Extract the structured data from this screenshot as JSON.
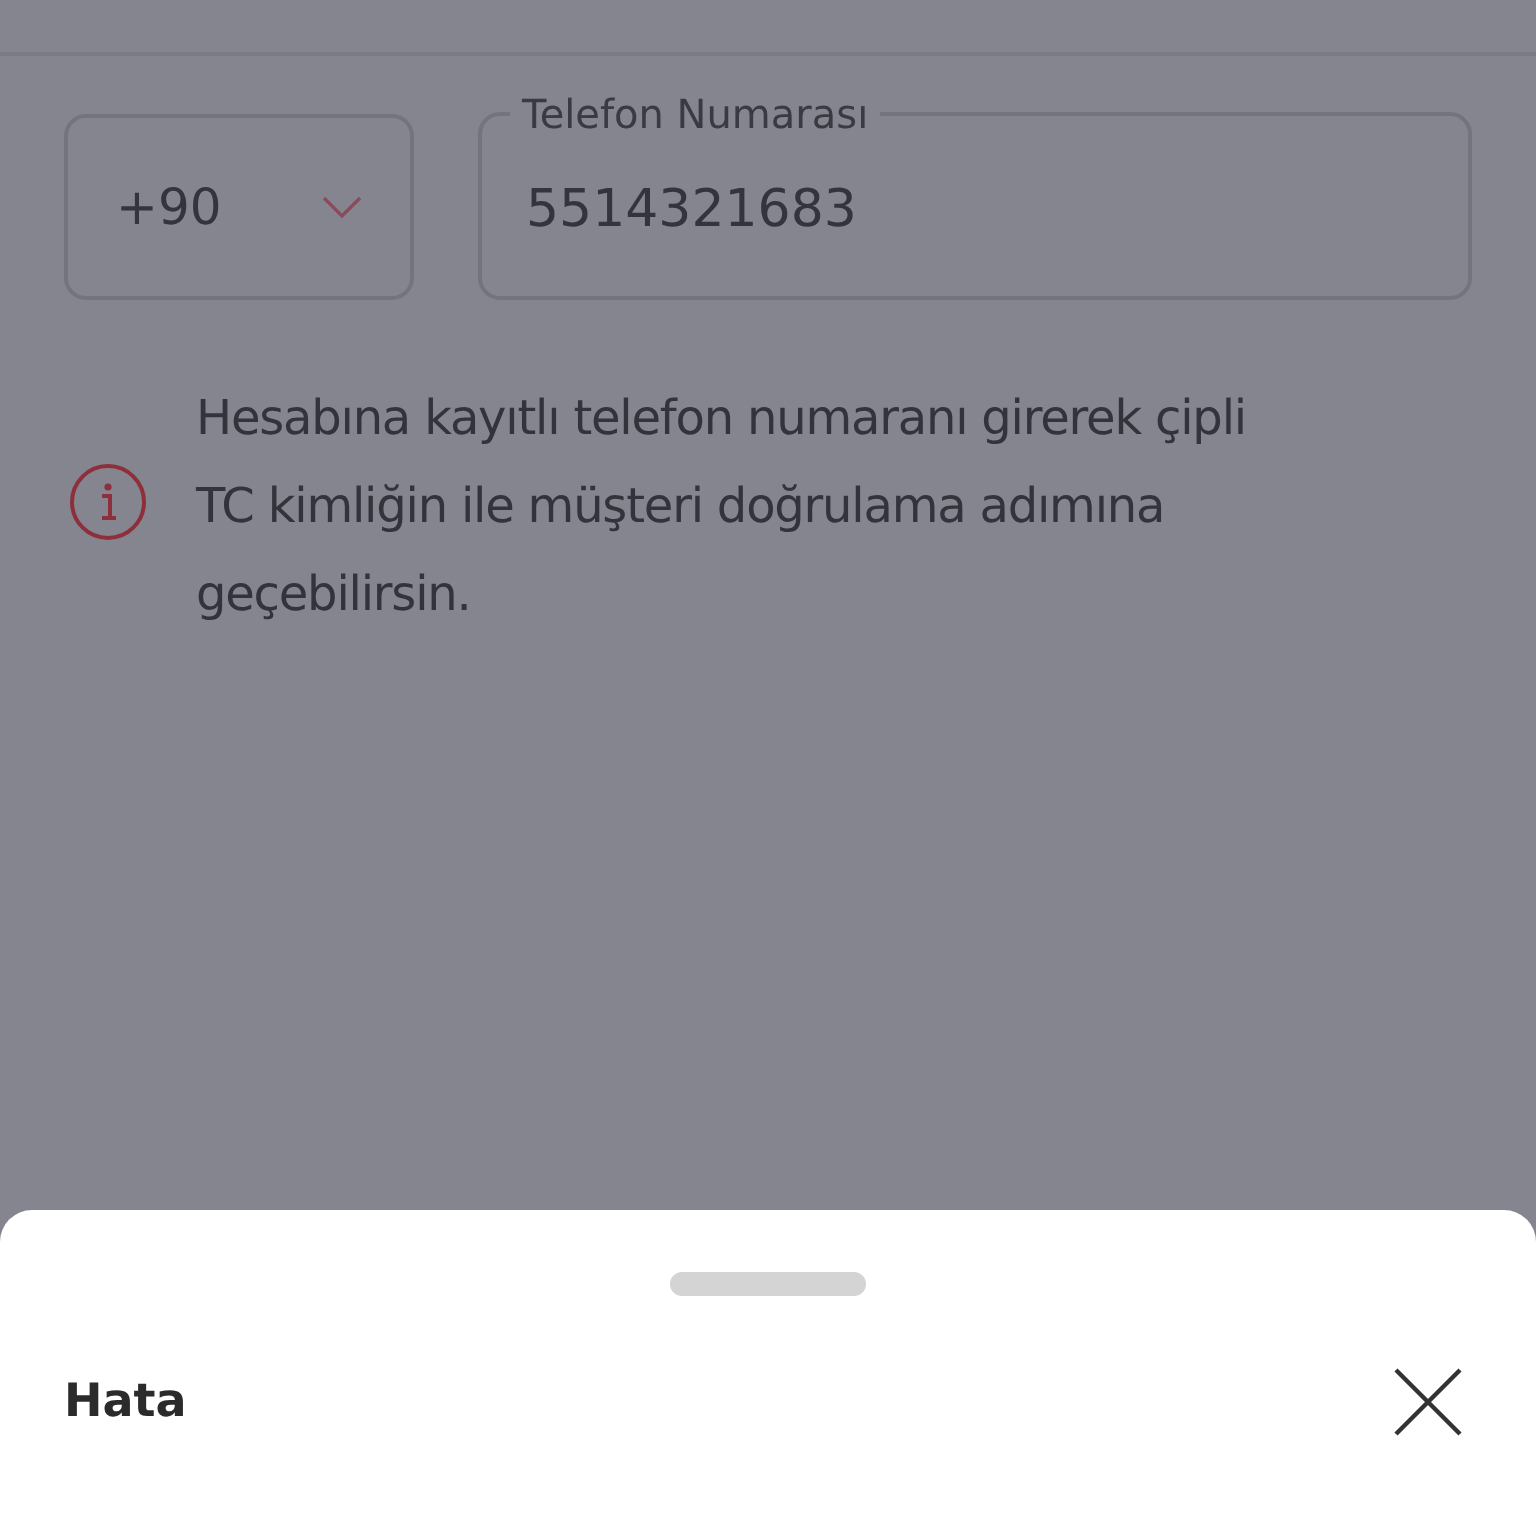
{
  "country_code": {
    "value": "+90"
  },
  "phone_field": {
    "label": "Telefon Numarası",
    "value": "5514321683"
  },
  "info": {
    "text": "Hesabına kayıtlı telefon numaranı girerek çipli TC kimliğin ile müşteri doğrulama adımına geçebilirsin."
  },
  "sheet": {
    "title": "Hata"
  }
}
